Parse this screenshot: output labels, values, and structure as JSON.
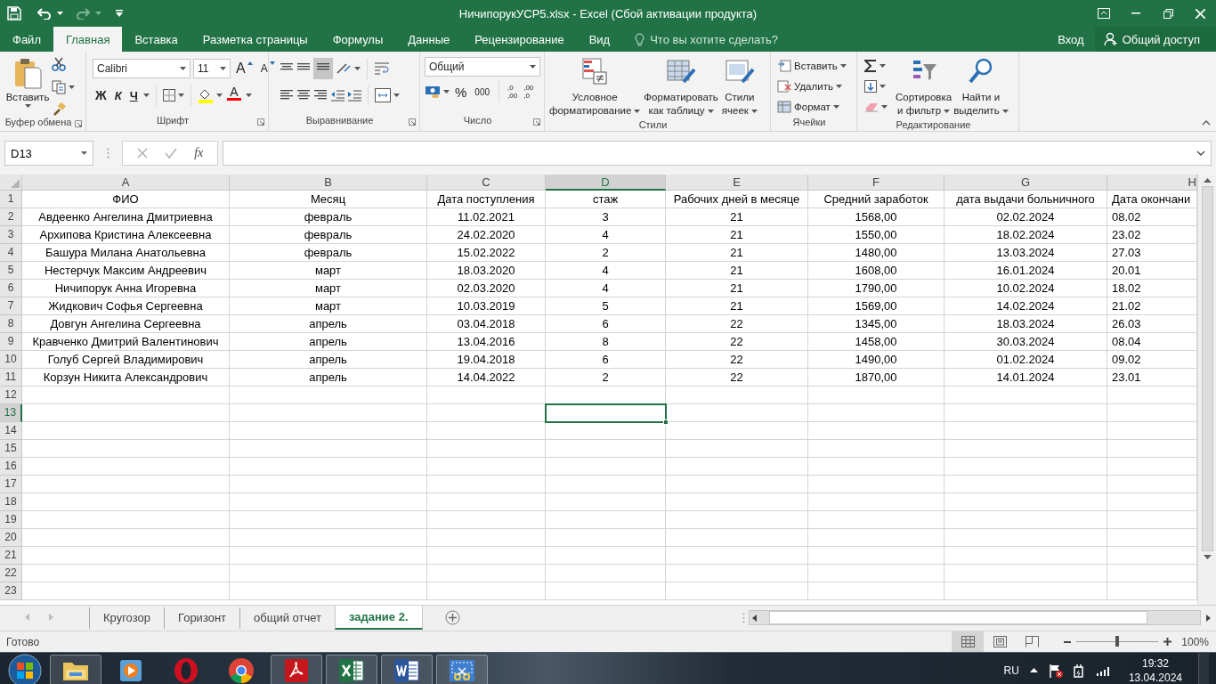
{
  "title_bar": {
    "title": "НичипорукУСР5.xlsx - Excel (Сбой активации продукта)",
    "redo_disabled": true
  },
  "ribbon_tabs": [
    {
      "label": "Файл",
      "selected": false
    },
    {
      "label": "Главная",
      "selected": true
    },
    {
      "label": "Вставка",
      "selected": false
    },
    {
      "label": "Разметка страницы",
      "selected": false
    },
    {
      "label": "Формулы",
      "selected": false
    },
    {
      "label": "Данные",
      "selected": false
    },
    {
      "label": "Рецензирование",
      "selected": false
    },
    {
      "label": "Вид",
      "selected": false
    }
  ],
  "tell_me": {
    "placeholder": "Что вы хотите сделать?"
  },
  "account": {
    "sign_in": "Вход",
    "share": "Общий доступ"
  },
  "ribbon": {
    "clipboard": {
      "label": "Буфер обмена",
      "paste": "Вставить"
    },
    "font": {
      "label": "Шрифт",
      "font_name": "Calibri",
      "font_size": "11",
      "grow": "A",
      "shrink": "A",
      "bold": "Ж",
      "italic": "К",
      "underline": "Ч",
      "font_color": "A"
    },
    "alignment": {
      "label": "Выравнивание"
    },
    "number": {
      "label": "Число",
      "format": "Общий",
      "percent": "%",
      "thousands": "000",
      "decimals": [
        [
          ",0",
          ",00"
        ],
        [
          ",00",
          ",0"
        ]
      ]
    },
    "styles": {
      "label": "Стили",
      "buttons": [
        {
          "kind": "conditional",
          "lines": [
            "Условное",
            "форматирование"
          ]
        },
        {
          "kind": "table",
          "lines": [
            "Форматировать",
            "как таблицу"
          ]
        },
        {
          "kind": "cellstyles",
          "lines": [
            "Стили",
            "ячеек"
          ]
        }
      ]
    },
    "cells": {
      "label": "Ячейки",
      "buttons": [
        {
          "kind": "insert",
          "label": "Вставить"
        },
        {
          "kind": "delete",
          "label": "Удалить"
        },
        {
          "kind": "format",
          "label": "Формат"
        }
      ]
    },
    "editing": {
      "label": "Редактирование",
      "buttons": [
        {
          "kind": "sort",
          "lines": [
            "Сортировка",
            "и фильтр"
          ]
        },
        {
          "kind": "find",
          "lines": [
            "Найти и",
            "выделить"
          ]
        }
      ]
    }
  },
  "formula_bar": {
    "name_box": "D13",
    "fx": "fx"
  },
  "sheet": {
    "columns": [
      {
        "label": "A",
        "selected": false
      },
      {
        "label": "B",
        "selected": false
      },
      {
        "label": "C",
        "selected": false
      },
      {
        "label": "D",
        "selected": true
      },
      {
        "label": "E",
        "selected": false
      },
      {
        "label": "F",
        "selected": false
      },
      {
        "label": "G",
        "selected": false
      },
      {
        "label": "H",
        "selected": false
      }
    ],
    "rows": [
      {
        "number": "1",
        "selected": false,
        "cells": [
          "ФИО",
          "Месяц",
          "Дата поступления",
          "стаж",
          "Рабочих дней в месяце",
          "Средний заработок",
          "дата выдачи больничного",
          "Дата окончани"
        ]
      },
      {
        "number": "2",
        "selected": false,
        "cells": [
          "Авдеенко Ангелина Дмитриевна",
          "февраль",
          "11.02.2021",
          "3",
          "21",
          "1568,00",
          "02.02.2024",
          "08.02"
        ]
      },
      {
        "number": "3",
        "selected": false,
        "cells": [
          "Архипова Кристина Алексеевна",
          "февраль",
          "24.02.2020",
          "4",
          "21",
          "1550,00",
          "18.02.2024",
          "23.02"
        ]
      },
      {
        "number": "4",
        "selected": false,
        "cells": [
          "Башура Милана Анатольевна",
          "февраль",
          "15.02.2022",
          "2",
          "21",
          "1480,00",
          "13.03.2024",
          "27.03"
        ]
      },
      {
        "number": "5",
        "selected": false,
        "cells": [
          "Нестерчук Максим Андреевич",
          "март",
          "18.03.2020",
          "4",
          "21",
          "1608,00",
          "16.01.2024",
          "20.01"
        ]
      },
      {
        "number": "6",
        "selected": false,
        "cells": [
          "Ничипорук Анна Игоревна",
          "март",
          "02.03.2020",
          "4",
          "21",
          "1790,00",
          "10.02.2024",
          "18.02"
        ]
      },
      {
        "number": "7",
        "selected": false,
        "cells": [
          "Жидкович Софья Сергеевна",
          "март",
          "10.03.2019",
          "5",
          "21",
          "1569,00",
          "14.02.2024",
          "21.02"
        ]
      },
      {
        "number": "8",
        "selected": false,
        "cells": [
          "Довгун Ангелина Сергеевна",
          "апрель",
          "03.04.2018",
          "6",
          "22",
          "1345,00",
          "18.03.2024",
          "26.03"
        ]
      },
      {
        "number": "9",
        "selected": false,
        "cells": [
          "Кравченко Дмитрий Валентинович",
          "апрель",
          "13.04.2016",
          "8",
          "22",
          "1458,00",
          "30.03.2024",
          "08.04"
        ]
      },
      {
        "number": "10",
        "selected": false,
        "cells": [
          "Голуб Сергей Владимирович",
          "апрель",
          "19.04.2018",
          "6",
          "22",
          "1490,00",
          "01.02.2024",
          "09.02"
        ]
      },
      {
        "number": "11",
        "selected": false,
        "cells": [
          "Корзун Никита Александрович",
          "апрель",
          "14.04.2022",
          "2",
          "22",
          "1870,00",
          "14.01.2024",
          "23.01"
        ]
      },
      {
        "number": "12",
        "selected": false
      },
      {
        "number": "13",
        "selected": true
      },
      {
        "number": "14",
        "selected": false
      },
      {
        "number": "15",
        "selected": false
      },
      {
        "number": "16",
        "selected": false
      },
      {
        "number": "17",
        "selected": false
      },
      {
        "number": "18",
        "selected": false
      },
      {
        "number": "19",
        "selected": false
      },
      {
        "number": "20",
        "selected": false
      },
      {
        "number": "21",
        "selected": false
      },
      {
        "number": "22",
        "selected": false
      },
      {
        "number": "23",
        "selected": false
      }
    ]
  },
  "sheet_tabs": [
    {
      "label": "Кругозор",
      "selected": false
    },
    {
      "label": "Горизонт",
      "selected": false
    },
    {
      "label": "общий отчет",
      "selected": false
    },
    {
      "label": "задание 2.",
      "selected": true
    }
  ],
  "status_bar": {
    "text": "Готово",
    "views": [
      {
        "kind": "normal",
        "selected": true
      },
      {
        "kind": "page_layout",
        "selected": false
      },
      {
        "kind": "page_break",
        "selected": false
      }
    ],
    "zoom_slider": {
      "level": 0.5
    },
    "zoom": "100%"
  },
  "taskbar": {
    "apps": [
      {
        "kind": "folder",
        "running": true
      },
      {
        "kind": "media",
        "running": false
      },
      {
        "kind": "opera",
        "running": false
      },
      {
        "kind": "chrome",
        "running": false
      },
      {
        "kind": "pdf",
        "running": true
      },
      {
        "kind": "excel",
        "running": true
      },
      {
        "kind": "word",
        "running": true
      },
      {
        "kind": "snip",
        "running": true
      }
    ],
    "language": "RU",
    "time": "19:32",
    "date": "13.04.2024"
  }
}
